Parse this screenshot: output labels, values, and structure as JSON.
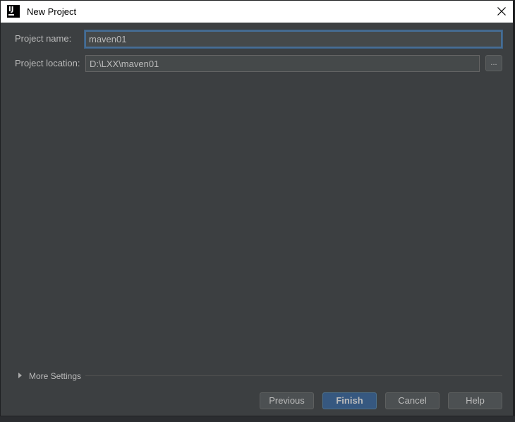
{
  "window": {
    "title": "New Project",
    "app_icon_text": "IJ"
  },
  "form": {
    "project_name": {
      "label": "Project name:",
      "value": "maven01"
    },
    "project_location": {
      "label": "Project location:",
      "value": "D:\\LXX\\maven01",
      "browse_label": "..."
    }
  },
  "more_settings": {
    "label": "More Settings"
  },
  "buttons": {
    "previous": "Previous",
    "finish": "Finish",
    "cancel": "Cancel",
    "help": "Help"
  },
  "colors": {
    "dialog_bg": "#3c3f41",
    "input_bg": "#45494a",
    "focus_border": "#466d94",
    "primary_button": "#365880",
    "text": "#bbbbbb"
  },
  "icons": {
    "app": "intellij-idea-icon",
    "close": "close-icon",
    "expand": "triangle-right-icon"
  }
}
